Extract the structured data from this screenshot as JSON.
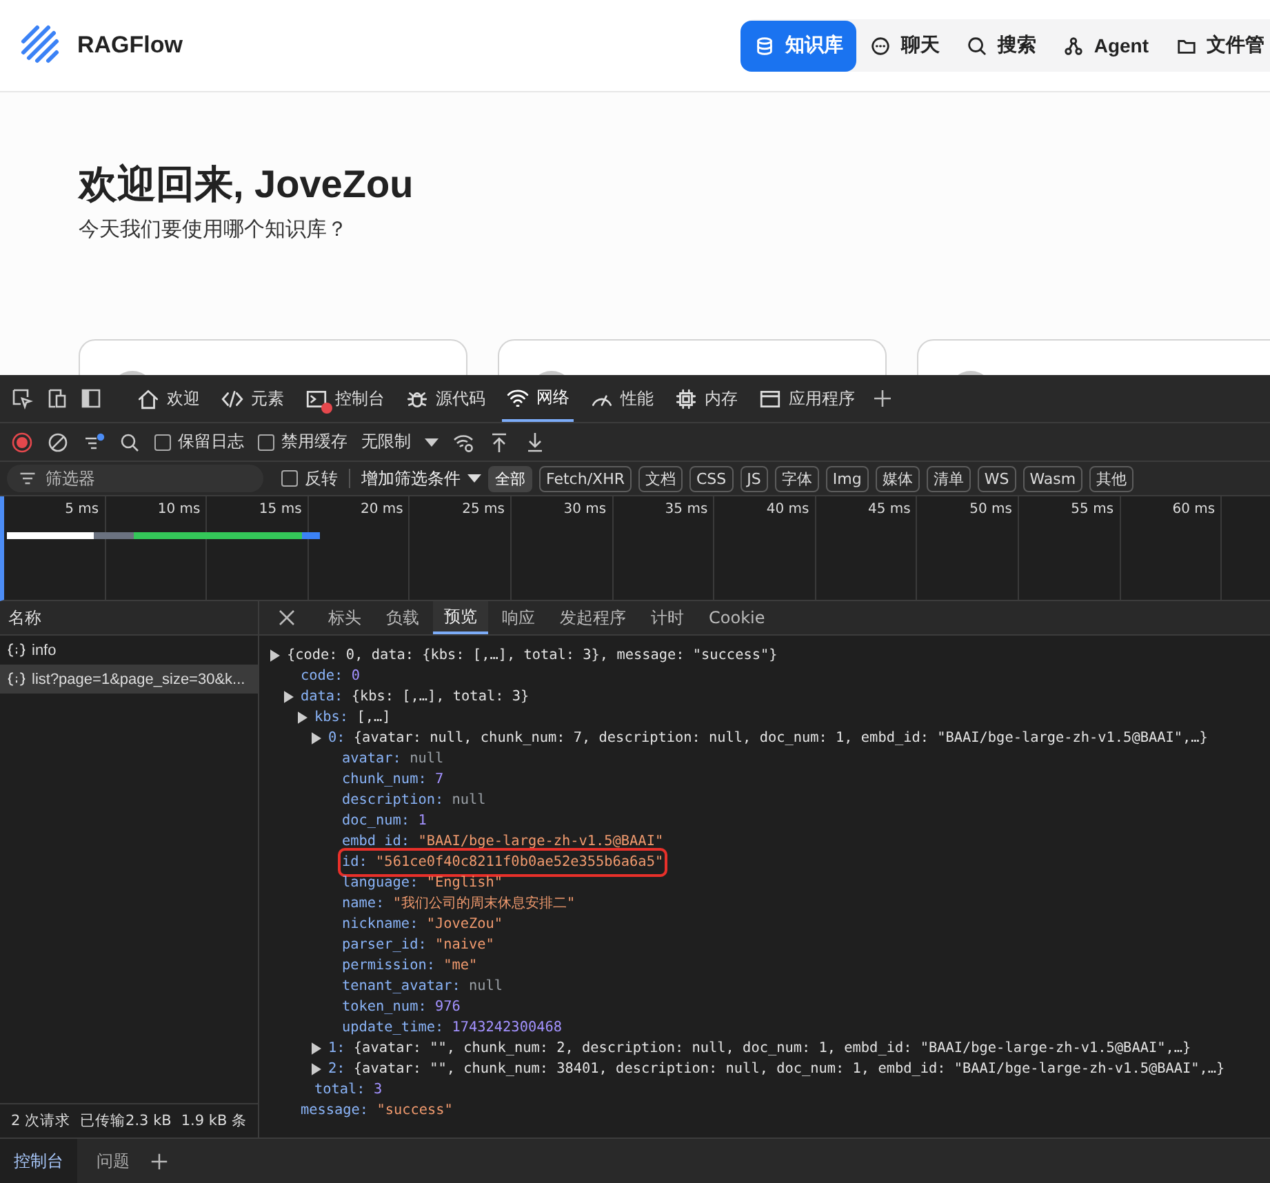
{
  "app": {
    "logo": "RAGFlow",
    "nav": [
      {
        "label": "知识库",
        "kind": "database",
        "selected": true
      },
      {
        "label": "聊天",
        "kind": "chat",
        "selected": false
      },
      {
        "label": "搜索",
        "kind": "search",
        "selected": false
      },
      {
        "label": "Agent",
        "kind": "agent",
        "selected": false
      },
      {
        "label": "文件管",
        "kind": "folder",
        "selected": false
      }
    ],
    "welcome_title": "欢迎回来, JoveZou",
    "welcome_subtitle": "今天我们要使用哪个知识库？",
    "cards": [
      {
        "kind": "knowledge_base"
      },
      {
        "kind": "knowledge_base"
      },
      {
        "kind": "knowledge_base"
      }
    ]
  },
  "devtools": {
    "tabs": [
      {
        "label": "欢迎",
        "kind": "home",
        "selected": false,
        "error_badge": false
      },
      {
        "label": "元素",
        "kind": "code",
        "selected": false,
        "error_badge": false
      },
      {
        "label": "控制台",
        "kind": "console",
        "selected": false,
        "error_badge": true
      },
      {
        "label": "源代码",
        "kind": "bug",
        "selected": false,
        "error_badge": false
      },
      {
        "label": "网络",
        "kind": "wifi",
        "selected": true,
        "error_badge": false
      },
      {
        "label": "性能",
        "kind": "gauge",
        "selected": false,
        "error_badge": false
      },
      {
        "label": "内存",
        "kind": "chip",
        "selected": false,
        "error_badge": false
      },
      {
        "label": "应用程序",
        "kind": "window",
        "selected": false,
        "error_badge": false
      }
    ],
    "toolbar": {
      "preserve_log": {
        "label": "保留日志",
        "checked": false
      },
      "disable_cache": {
        "label": "禁用缓存",
        "checked": false
      },
      "throttling": "无限制"
    },
    "filter": {
      "placeholder": "筛选器",
      "invert": {
        "label": "反转",
        "checked": false
      },
      "more_filters": "增加筛选条件",
      "types": [
        {
          "label": "全部",
          "selected": true
        },
        {
          "label": "Fetch/XHR",
          "selected": false
        },
        {
          "label": "文档",
          "selected": false
        },
        {
          "label": "CSS",
          "selected": false
        },
        {
          "label": "JS",
          "selected": false
        },
        {
          "label": "字体",
          "selected": false
        },
        {
          "label": "Img",
          "selected": false
        },
        {
          "label": "媒体",
          "selected": false
        },
        {
          "label": "清单",
          "selected": false
        },
        {
          "label": "WS",
          "selected": false
        },
        {
          "label": "Wasm",
          "selected": false
        },
        {
          "label": "其他",
          "selected": false
        }
      ]
    },
    "timeline": {
      "ticks": [
        "5 ms",
        "10 ms",
        "15 ms",
        "20 ms",
        "25 ms",
        "30 ms",
        "35 ms",
        "40 ms",
        "45 ms",
        "50 ms",
        "55 ms",
        "60 ms"
      ]
    },
    "requests": {
      "header": "名称",
      "items": [
        {
          "name": "info",
          "selected": false
        },
        {
          "name": "list?page=1&page_size=30&k...",
          "selected": true
        }
      ],
      "summary": [
        "2 次请求",
        "已传输2.3 kB",
        "1.9 kB 条"
      ]
    },
    "detail": {
      "tabs": [
        {
          "label": "标头",
          "selected": false
        },
        {
          "label": "负载",
          "selected": false
        },
        {
          "label": "预览",
          "selected": true
        },
        {
          "label": "响应",
          "selected": false
        },
        {
          "label": "发起程序",
          "selected": false
        },
        {
          "label": "计时",
          "selected": false
        },
        {
          "label": "Cookie",
          "selected": false
        }
      ],
      "preview": [
        {
          "kind": "summary",
          "value": "{code: 0, data: {kbs: [,…], total: 3}, message: \"success\"}",
          "children": [
            {
              "kind": "number",
              "key": "code:",
              "value": "0"
            },
            {
              "kind": "summary",
              "key": "data:",
              "value": "{kbs: [,…], total: 3}",
              "children": [
                {
                  "kind": "summary",
                  "key": "kbs:",
                  "value": "[,…]",
                  "children": [
                    {
                      "kind": "summary",
                      "key": "0:",
                      "value": "{avatar: null, chunk_num: 7, description: null, doc_num: 1, embd_id: \"BAAI/bge-large-zh-v1.5@BAAI\",…}",
                      "children": [
                        {
                          "kind": "null",
                          "key": "avatar:",
                          "value": "null",
                          "highlighted": false
                        },
                        {
                          "kind": "number",
                          "key": "chunk_num:",
                          "value": "7",
                          "highlighted": false
                        },
                        {
                          "kind": "null",
                          "key": "description:",
                          "value": "null",
                          "highlighted": false
                        },
                        {
                          "kind": "number",
                          "key": "doc_num:",
                          "value": "1",
                          "highlighted": false
                        },
                        {
                          "kind": "string",
                          "key": "embd_id:",
                          "value": "\"BAAI/bge-large-zh-v1.5@BAAI\"",
                          "highlighted": false
                        },
                        {
                          "kind": "string",
                          "key": "id:",
                          "value": "\"561ce0f40c8211f0b0ae52e355b6a6a5\"",
                          "highlighted": true
                        },
                        {
                          "kind": "string",
                          "key": "language:",
                          "value": "\"English\"",
                          "highlighted": false
                        },
                        {
                          "kind": "string",
                          "key": "name:",
                          "value": "\"我们公司的周末休息安排二\"",
                          "highlighted": false
                        },
                        {
                          "kind": "string",
                          "key": "nickname:",
                          "value": "\"JoveZou\"",
                          "highlighted": false
                        },
                        {
                          "kind": "string",
                          "key": "parser_id:",
                          "value": "\"naive\"",
                          "highlighted": false
                        },
                        {
                          "kind": "string",
                          "key": "permission:",
                          "value": "\"me\"",
                          "highlighted": false
                        },
                        {
                          "kind": "null",
                          "key": "tenant_avatar:",
                          "value": "null",
                          "highlighted": false
                        },
                        {
                          "kind": "number",
                          "key": "token_num:",
                          "value": "976",
                          "highlighted": false
                        },
                        {
                          "kind": "number",
                          "key": "update_time:",
                          "value": "1743242300468",
                          "highlighted": false
                        }
                      ]
                    },
                    {
                      "kind": "summary",
                      "key": "1:",
                      "value": "{avatar: \"\", chunk_num: 2, description: null, doc_num: 1, embd_id: \"BAAI/bge-large-zh-v1.5@BAAI\",…}"
                    },
                    {
                      "kind": "summary",
                      "key": "2:",
                      "value": "{avatar: \"\", chunk_num: 38401, description: null, doc_num: 1, embd_id: \"BAAI/bge-large-zh-v1.5@BAAI\",…}"
                    }
                  ]
                },
                {
                  "kind": "number",
                  "key": "total:",
                  "value": "3"
                }
              ]
            },
            {
              "kind": "string",
              "key": "message:",
              "value": "\"success\""
            }
          ]
        }
      ]
    },
    "drawer": {
      "tabs": [
        {
          "label": "控制台",
          "selected": true
        },
        {
          "label": "问题",
          "selected": false
        }
      ]
    }
  }
}
